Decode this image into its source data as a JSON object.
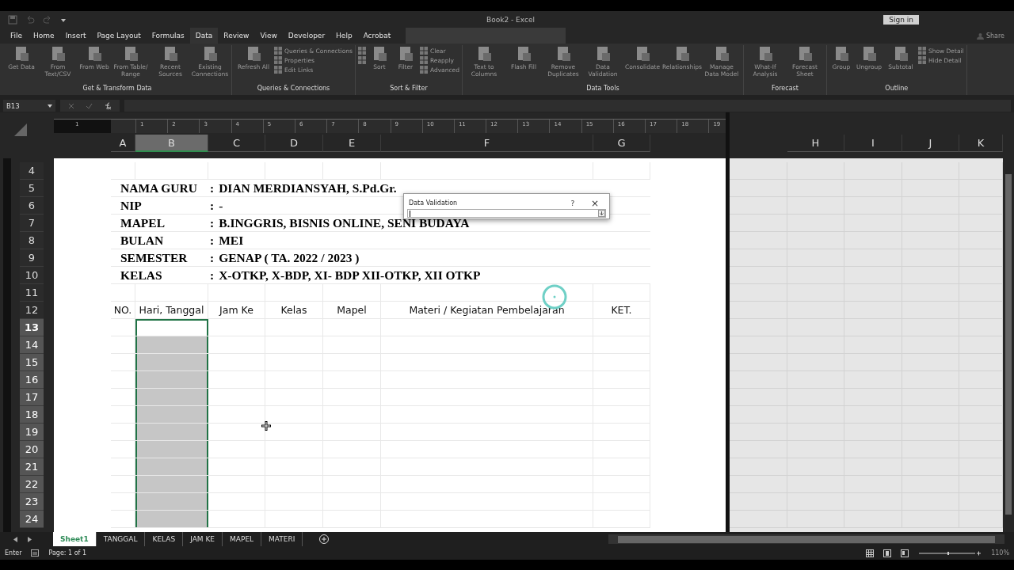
{
  "window": {
    "title": "Book2  -  Excel",
    "sign_in": "Sign in",
    "share": "Share"
  },
  "tabs": [
    {
      "label": "File",
      "selected": false
    },
    {
      "label": "Home",
      "selected": false
    },
    {
      "label": "Insert",
      "selected": false
    },
    {
      "label": "Page Layout",
      "selected": false
    },
    {
      "label": "Formulas",
      "selected": false
    },
    {
      "label": "Data",
      "selected": true
    },
    {
      "label": "Review",
      "selected": false
    },
    {
      "label": "View",
      "selected": false
    },
    {
      "label": "Developer",
      "selected": false
    },
    {
      "label": "Help",
      "selected": false
    },
    {
      "label": "Acrobat",
      "selected": false
    }
  ],
  "ribbon": {
    "groups": [
      {
        "label": "Get & Transform Data",
        "buttons": [
          {
            "kind": "large",
            "label": "Get Data",
            "disabled": true
          },
          {
            "kind": "large",
            "label": "From Text/CSV",
            "disabled": true
          },
          {
            "kind": "large",
            "label": "From Web",
            "disabled": true
          },
          {
            "kind": "large",
            "label": "From Table/ Range",
            "disabled": true
          },
          {
            "kind": "large",
            "label": "Recent Sources",
            "disabled": true
          },
          {
            "kind": "large",
            "label": "Existing Connections",
            "disabled": true
          }
        ]
      },
      {
        "label": "Queries & Connections",
        "buttons": [
          {
            "kind": "large",
            "label": "Refresh All",
            "disabled": true
          },
          {
            "kind": "small",
            "label": "Queries & Connections",
            "disabled": true
          },
          {
            "kind": "small",
            "label": "Properties",
            "disabled": true
          },
          {
            "kind": "small",
            "label": "Edit Links",
            "disabled": true
          }
        ]
      },
      {
        "label": "Sort & Filter",
        "buttons": [
          {
            "kind": "icon",
            "disabled": true
          },
          {
            "kind": "icon",
            "disabled": true
          },
          {
            "kind": "large",
            "label": "Sort",
            "disabled": true
          },
          {
            "kind": "large",
            "label": "Filter",
            "disabled": true
          },
          {
            "kind": "small",
            "label": "Clear",
            "disabled": true
          },
          {
            "kind": "small",
            "label": "Reapply",
            "disabled": true
          },
          {
            "kind": "small",
            "label": "Advanced",
            "disabled": true
          }
        ]
      },
      {
        "label": "Data Tools",
        "buttons": [
          {
            "kind": "large",
            "label": "Text to Columns",
            "disabled": true
          },
          {
            "kind": "large",
            "label": "Flash Fill",
            "disabled": true
          },
          {
            "kind": "large",
            "label": "Remove Duplicates",
            "disabled": true
          },
          {
            "kind": "large",
            "label": "Data Validation",
            "disabled": true
          },
          {
            "kind": "large",
            "label": "Consolidate",
            "disabled": true
          },
          {
            "kind": "large",
            "label": "Relationships",
            "disabled": true
          },
          {
            "kind": "large",
            "label": "Manage Data Model",
            "disabled": true
          }
        ]
      },
      {
        "label": "Forecast",
        "buttons": [
          {
            "kind": "large",
            "label": "What-If Analysis",
            "disabled": true
          },
          {
            "kind": "large",
            "label": "Forecast Sheet",
            "disabled": true
          }
        ]
      },
      {
        "label": "Outline",
        "buttons": [
          {
            "kind": "large",
            "label": "Group",
            "disabled": true
          },
          {
            "kind": "large",
            "label": "Ungroup",
            "disabled": true
          },
          {
            "kind": "large",
            "label": "Subtotal",
            "disabled": true
          },
          {
            "kind": "small",
            "label": "Show Detail",
            "disabled": true
          },
          {
            "kind": "small",
            "label": "Hide Detail",
            "disabled": true
          }
        ]
      }
    ]
  },
  "formula_bar": {
    "name_box": "B13"
  },
  "ruler": [
    "1",
    "1",
    "2",
    "3",
    "4",
    "5",
    "6",
    "7",
    "8",
    "9",
    "10",
    "11",
    "12",
    "13",
    "14",
    "15",
    "16",
    "17",
    "18",
    "19"
  ],
  "columns": [
    {
      "label": "A",
      "selected": false
    },
    {
      "label": "B",
      "selected": true
    },
    {
      "label": "C",
      "selected": false
    },
    {
      "label": "D",
      "selected": false
    },
    {
      "label": "E",
      "selected": false
    },
    {
      "label": "F",
      "selected": false
    },
    {
      "label": "G",
      "selected": false
    }
  ],
  "right_columns": [
    {
      "label": "H",
      "selected": false
    },
    {
      "label": "I",
      "selected": false
    },
    {
      "label": "J",
      "selected": false
    },
    {
      "label": "K",
      "selected": false
    }
  ],
  "rows": [
    {
      "label": "4",
      "selected": false,
      "active": false
    },
    {
      "label": "5",
      "selected": false,
      "active": false
    },
    {
      "label": "6",
      "selected": false,
      "active": false
    },
    {
      "label": "7",
      "selected": false,
      "active": false
    },
    {
      "label": "8",
      "selected": false,
      "active": false
    },
    {
      "label": "9",
      "selected": false,
      "active": false
    },
    {
      "label": "10",
      "selected": false,
      "active": false
    },
    {
      "label": "11",
      "selected": false,
      "active": false
    },
    {
      "label": "12",
      "selected": false,
      "active": false
    },
    {
      "label": "13",
      "selected": true,
      "active": true
    },
    {
      "label": "14",
      "selected": true,
      "active": false
    },
    {
      "label": "15",
      "selected": true,
      "active": false
    },
    {
      "label": "16",
      "selected": true,
      "active": false
    },
    {
      "label": "17",
      "selected": true,
      "active": false
    },
    {
      "label": "18",
      "selected": true,
      "active": false
    },
    {
      "label": "19",
      "selected": true,
      "active": false
    },
    {
      "label": "20",
      "selected": true,
      "active": false
    },
    {
      "label": "21",
      "selected": true,
      "active": false
    },
    {
      "label": "22",
      "selected": true,
      "active": false
    },
    {
      "label": "23",
      "selected": true,
      "active": false
    },
    {
      "label": "24",
      "selected": true,
      "active": false
    }
  ],
  "info": [
    {
      "label": "NAMA GURU",
      "separator": ":",
      "value": "DIAN MERDIANSYAH, S.Pd.Gr."
    },
    {
      "label": "NIP",
      "separator": ":",
      "value": "-"
    },
    {
      "label": "MAPEL",
      "separator": ":",
      "value": "B.INGGRIS, BISNIS ONLINE, SENI BUDAYA"
    },
    {
      "label": "BULAN",
      "separator": ":",
      "value": "MEI"
    },
    {
      "label": "SEMESTER",
      "separator": ":",
      "value": "GENAP ( TA. 2022 / 2023 )"
    },
    {
      "label": "KELAS",
      "separator": ":",
      "value": "X-OTKP, X-BDP, XI- BDP  XII-OTKP, XII OTKP"
    }
  ],
  "header_row": [
    "NO.",
    "Hari, Tanggal",
    "Jam Ke",
    "Kelas",
    "Mapel",
    "Materi / Kegiatan Pembelajaran",
    "KET."
  ],
  "dialog": {
    "title": "Data Validation",
    "help": "?",
    "close": "×"
  },
  "sheet_tabs": [
    {
      "label": "Sheet1",
      "selected": true
    },
    {
      "label": "TANGGAL",
      "selected": false
    },
    {
      "label": "KELAS",
      "selected": false
    },
    {
      "label": "JAM KE",
      "selected": false
    },
    {
      "label": "MAPEL",
      "selected": false
    },
    {
      "label": "MATERI",
      "selected": false
    }
  ],
  "status_bar": {
    "mode": "Enter",
    "page": "Page: 1 of 1",
    "zoom": "110%"
  }
}
